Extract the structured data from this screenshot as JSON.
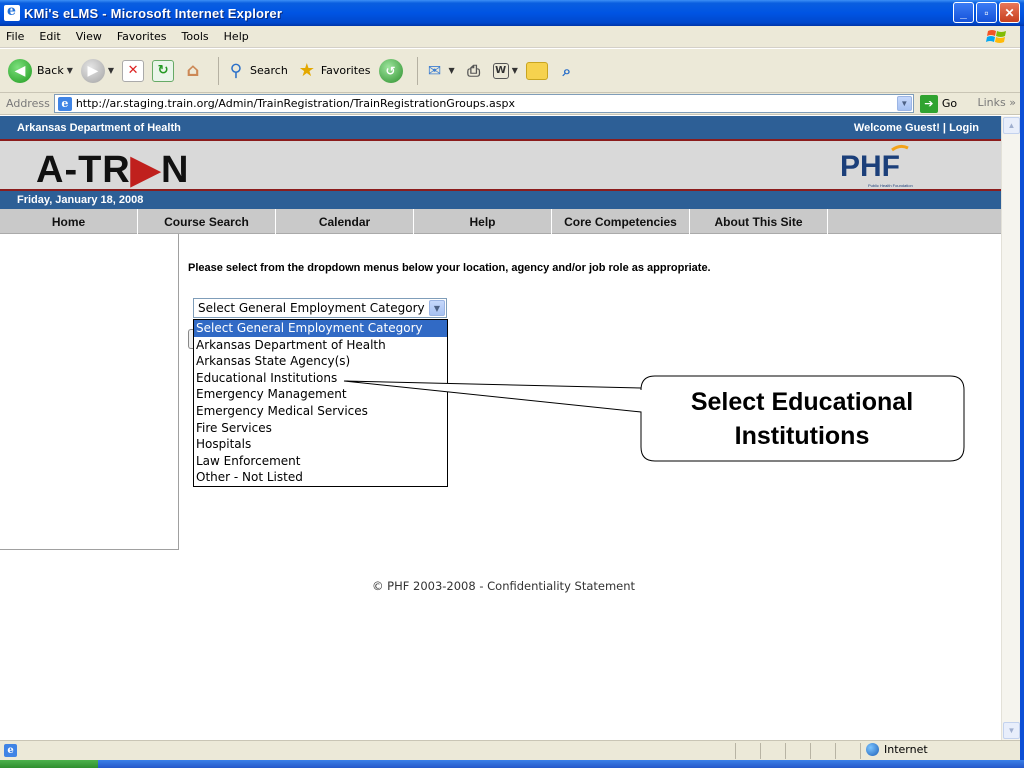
{
  "window": {
    "title": "KMi's eLMS - Microsoft Internet Explorer",
    "controls": [
      "_",
      "▫",
      "✕"
    ]
  },
  "menu": [
    "File",
    "Edit",
    "View",
    "Favorites",
    "Tools",
    "Help"
  ],
  "toolbar": {
    "back_label": "Back",
    "search_label": "Search",
    "favorites_label": "Favorites"
  },
  "address": {
    "label": "Address",
    "url": "http://ar.staging.train.org/Admin/TrainRegistration/TrainRegistrationGroups.aspx",
    "go_label": "Go",
    "links_label": "Links"
  },
  "site": {
    "org_name": "Arkansas Department of Health",
    "welcome": "Welcome Guest! | Login",
    "logo_text": [
      "A-TR",
      "N"
    ],
    "logo_phf": "PHF",
    "logo_phf_sub": "Public Health Foundation",
    "date": "Friday, January 18, 2008",
    "nav": [
      "Home",
      "Course Search",
      "Calendar",
      "Help",
      "Core Competencies",
      "About This Site"
    ]
  },
  "form": {
    "instruction": "Please select from the dropdown menus below your location, agency and/or job role as appropriate.",
    "select_value": "Select General Employment Category",
    "options": [
      "Select General Employment Category",
      "Arkansas Department of Health",
      "Arkansas State Agency(s)",
      "Educational Institutions",
      "Emergency Management",
      "Emergency Medical Services",
      "Fire Services",
      "Hospitals",
      "Law Enforcement",
      "Other - Not Listed"
    ],
    "selected_index": 0
  },
  "callout": {
    "line1": "Select Educational",
    "line2": "Institutions"
  },
  "footer": "© PHF 2003-2008 - Confidentiality Statement",
  "status": {
    "zone": "Internet"
  },
  "colors": {
    "site_blue": "#2d5f96",
    "banner_red": "#8b1d1d",
    "highlight": "#316ac5"
  }
}
